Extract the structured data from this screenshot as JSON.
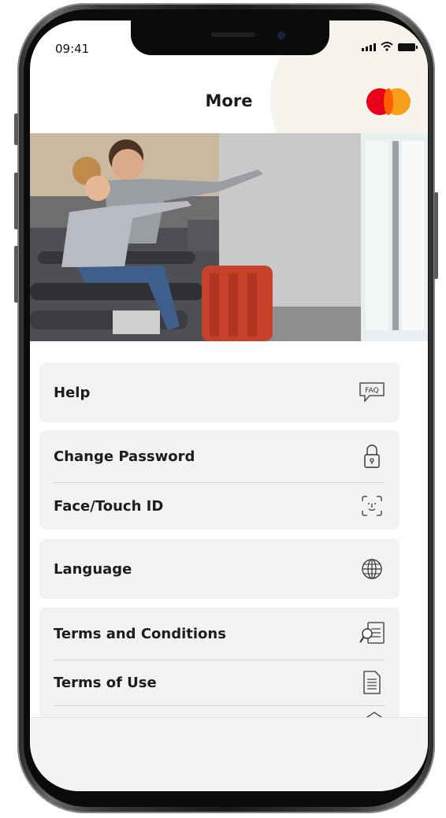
{
  "status_bar": {
    "time": "09:41"
  },
  "header": {
    "title": "More",
    "brand_logo": "mastercard-logo"
  },
  "hero": {
    "image": "family-at-airport-photo"
  },
  "menu": {
    "help": {
      "label": "Help",
      "icon": "faq-icon"
    },
    "change_password": {
      "label": "Change Password",
      "icon": "lock-icon"
    },
    "face_touch_id": {
      "label": "Face/Touch ID",
      "icon": "face-id-icon"
    },
    "language": {
      "label": "Language",
      "icon": "globe-icon"
    },
    "terms_conditions": {
      "label": "Terms and Conditions",
      "icon": "document-search-icon"
    },
    "terms_of_use": {
      "label": "Terms of Use",
      "icon": "document-icon"
    }
  },
  "icon_text": {
    "faq": "FAQ"
  },
  "colors": {
    "accent_arc": "#e7a32e",
    "mc_red": "#eb001b",
    "mc_yellow": "#f79e1b",
    "card_bg": "#f2f2f2"
  }
}
